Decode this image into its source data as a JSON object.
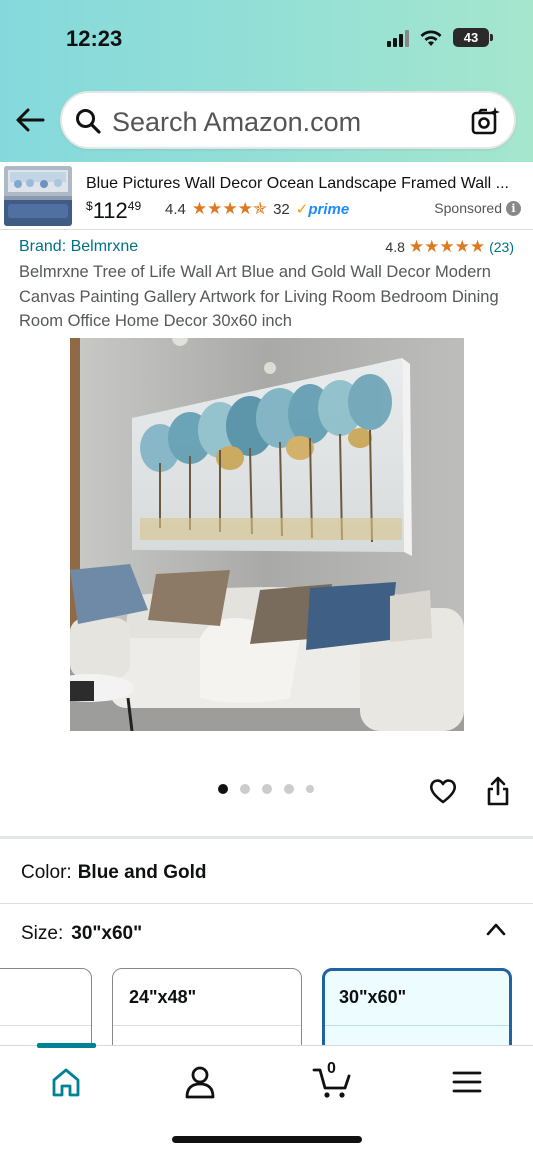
{
  "status_bar": {
    "time": "12:23",
    "battery": "43"
  },
  "search": {
    "placeholder": "Search Amazon.com"
  },
  "sponsored_ad": {
    "title": "Blue Pictures Wall Decor Ocean Landscape Framed Wall ...",
    "price_dollar": "$",
    "price_whole": "112",
    "price_fraction": "49",
    "rating": "4.4",
    "stars": "★★★★✯",
    "review_count": "32",
    "prime_label": "prime",
    "sponsored_label": "Sponsored"
  },
  "product": {
    "brand": "Brand: Belmrxne",
    "rating": "4.8",
    "stars": "★★★★★",
    "review_count": "(23)",
    "title": "Belmrxne Tree of Life Wall Art Blue and Gold Wall Decor Modern Canvas Painting Gallery Artwork for Living Room Bedroom Dining Room Office Home Decor 30x60 inch",
    "image_count": 5,
    "active_image": 1
  },
  "variations": {
    "color_label": "Color:",
    "color_value": "Blue and Gold",
    "size_label": "Size:",
    "size_value": "30\"x60\"",
    "sizes": [
      "",
      "24\"x48\"",
      "30\"x60\""
    ]
  },
  "bottom_nav": {
    "cart_count": "0"
  },
  "colors": {
    "link": "#007185",
    "star": "#de7921",
    "selected_border": "#2162a1",
    "nav_accent": "#008296"
  }
}
